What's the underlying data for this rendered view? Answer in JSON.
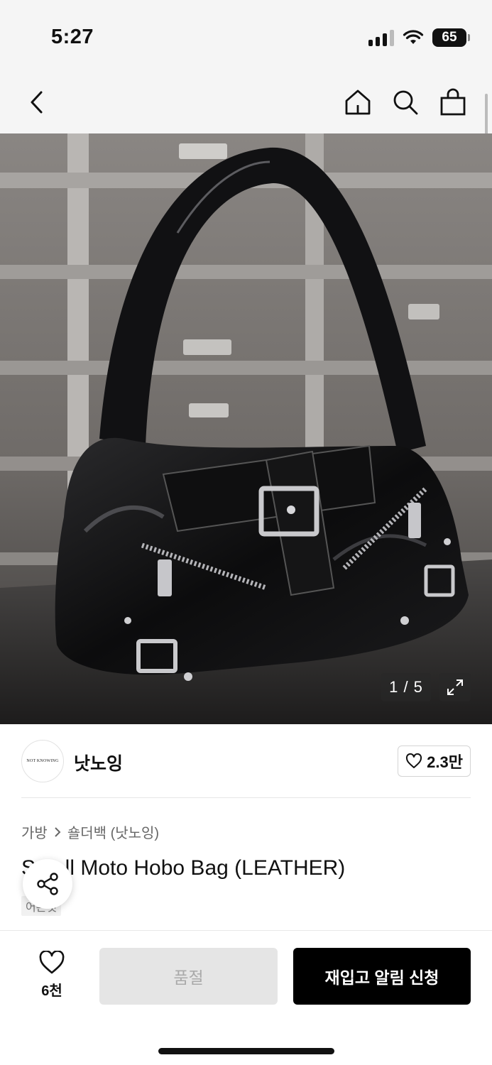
{
  "status_bar": {
    "time": "5:27",
    "battery": "65"
  },
  "nav": {
    "back_icon": "chevron-left-icon",
    "home_icon": "home-icon",
    "search_icon": "search-icon",
    "cart_icon": "shopping-bag-icon"
  },
  "gallery": {
    "counter": "1 / 5",
    "expand_icon": "expand-icon"
  },
  "brand": {
    "logo_text": "NOT KNOWING",
    "name": "낫노잉",
    "likes": "2.3만"
  },
  "breadcrumb": [
    "가방",
    "숄더백 (낫노잉)"
  ],
  "product": {
    "title": "Small Moto Hobo Bag (LEATHER)",
    "tag": "어른것"
  },
  "share_icon": "share-icon",
  "bottom_bar": {
    "wish_count": "6천",
    "soldout_label": "품절",
    "restock_label": "재입고 알림 신청"
  },
  "colors": {
    "primary": "#000000",
    "disabled_bg": "#e5e5e5",
    "nav_bg": "#f5f5f5"
  }
}
